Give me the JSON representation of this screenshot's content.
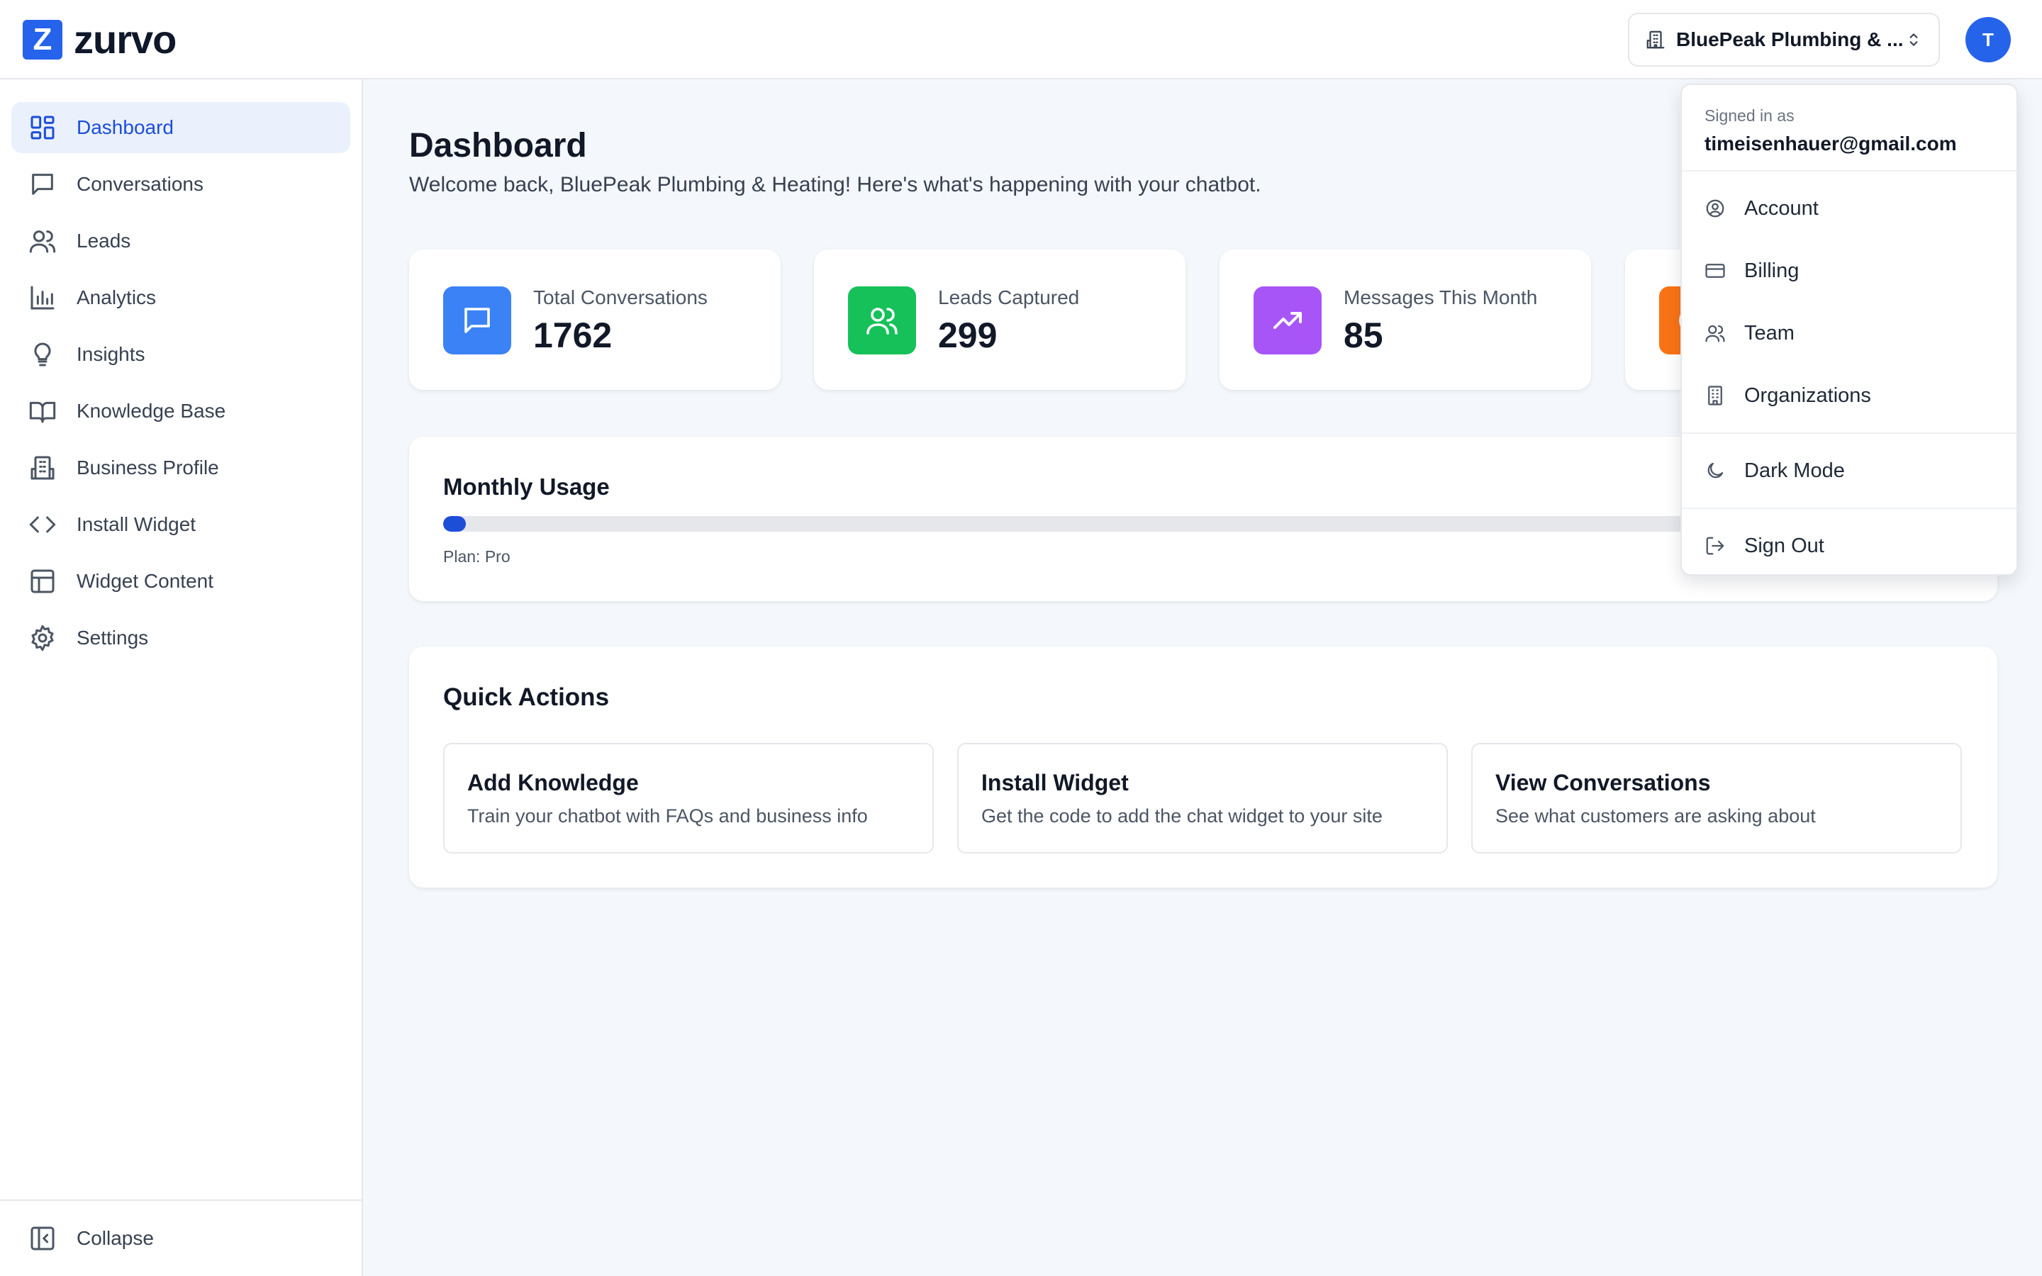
{
  "app": {
    "logo_letter": "Z",
    "logo_text": "zurvo"
  },
  "header": {
    "org_name": "BluePeak Plumbing & ...",
    "avatar_initial": "T"
  },
  "sidebar": {
    "items": [
      {
        "label": "Dashboard",
        "icon": "dashboard-icon"
      },
      {
        "label": "Conversations",
        "icon": "chat-icon"
      },
      {
        "label": "Leads",
        "icon": "users-icon"
      },
      {
        "label": "Analytics",
        "icon": "bar-chart-icon"
      },
      {
        "label": "Insights",
        "icon": "lightbulb-icon"
      },
      {
        "label": "Knowledge Base",
        "icon": "book-icon"
      },
      {
        "label": "Business Profile",
        "icon": "building-icon"
      },
      {
        "label": "Install Widget",
        "icon": "code-icon"
      },
      {
        "label": "Widget Content",
        "icon": "layout-icon"
      },
      {
        "label": "Settings",
        "icon": "gear-icon"
      }
    ],
    "collapse_label": "Collapse"
  },
  "main": {
    "title": "Dashboard",
    "subtitle": "Welcome back, BluePeak Plumbing & Heating! Here's what's happening with your chatbot.",
    "stats": [
      {
        "label": "Total Conversations",
        "value": "1762",
        "color": "#3b82f6",
        "icon": "chat-icon"
      },
      {
        "label": "Leads Captured",
        "value": "299",
        "color": "#16c15a",
        "icon": "users-icon"
      },
      {
        "label": "Messages This Month",
        "value": "85",
        "color": "#a855f7",
        "icon": "trending-up-icon"
      },
      {
        "label": "",
        "value": "",
        "color": "#f97316",
        "icon": "clock-icon"
      }
    ],
    "usage": {
      "title": "Monthly Usage",
      "percent": 1.5,
      "plan": "Plan: Pro"
    },
    "quick_actions": {
      "title": "Quick Actions",
      "items": [
        {
          "title": "Add Knowledge",
          "desc": "Train your chatbot with FAQs and business info"
        },
        {
          "title": "Install Widget",
          "desc": "Get the code to add the chat widget to your site"
        },
        {
          "title": "View Conversations",
          "desc": "See what customers are asking about"
        }
      ]
    }
  },
  "user_menu": {
    "signed_in_label": "Signed in as",
    "email": "timeisenhauer@gmail.com",
    "items": [
      {
        "label": "Account",
        "icon": "user-circle-icon"
      },
      {
        "label": "Billing",
        "icon": "credit-card-icon"
      },
      {
        "label": "Team",
        "icon": "users-icon"
      },
      {
        "label": "Organizations",
        "icon": "building-icon"
      }
    ],
    "dark_mode_label": "Dark Mode",
    "sign_out_label": "Sign Out"
  },
  "colors": {
    "accent": "#2563eb",
    "active_bg": "#eaf1fd"
  }
}
